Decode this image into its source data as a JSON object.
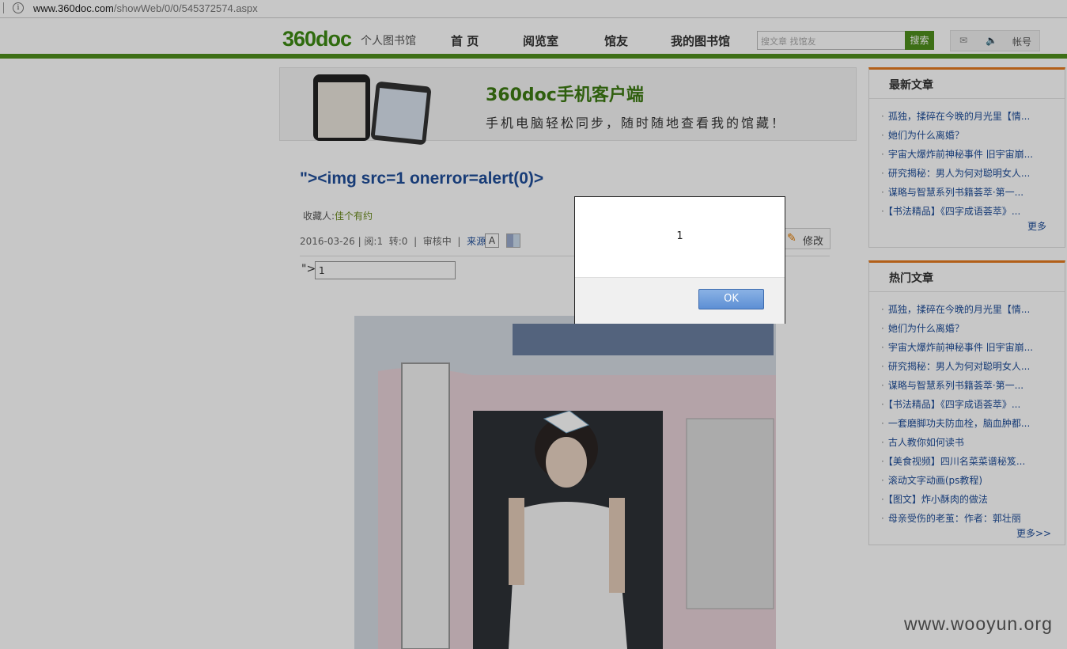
{
  "browser": {
    "url_domain": "www.360doc.com",
    "url_path": "/showWeb/0/0/545372574.aspx",
    "info_icon": "info-icon"
  },
  "header": {
    "logo": "360doc",
    "logo_sub": "个人图书馆",
    "nav": [
      "首 页",
      "阅览室",
      "馆友",
      "我的图书馆"
    ],
    "search_placeholder": "搜文章 找馆友",
    "search_button": "搜索",
    "account": "帐号",
    "icons": [
      "mail-icon",
      "sound-icon"
    ]
  },
  "banner": {
    "title": "360doc手机客户端",
    "subtitle": "手机电脑轻松同步，随时随地查看我的馆藏！"
  },
  "article": {
    "title": "\"><img src=1 onerror=alert(0)>",
    "collector_label": "收藏人:",
    "collector_name": "佳个有约",
    "date": "2016-03-26",
    "reads": "阅:1",
    "reposts": "转:0",
    "status": "审核中",
    "source": "来源",
    "font_button": "A",
    "edit_button": "修改",
    "quote_prefix": "\">",
    "input_value": "1"
  },
  "sidebar": {
    "latest": {
      "title": "最新文章",
      "items": [
        "孤独，揉碎在今晚的月光里【情...",
        "她们为什么离婚？",
        "宇宙大爆炸前神秘事件 旧宇宙崩...",
        "研究揭秘：男人为何对聪明女人...",
        "谋略与智慧系列书籍荟萃·第一...",
        "【书法精品】《四字成语荟萃》..."
      ],
      "more": "更多"
    },
    "hot": {
      "title": "热门文章",
      "items": [
        "孤独，揉碎在今晚的月光里【情...",
        "她们为什么离婚？",
        "宇宙大爆炸前神秘事件 旧宇宙崩...",
        "研究揭秘：男人为何对聪明女人...",
        "谋略与智慧系列书籍荟萃·第一...",
        "【书法精品】《四字成语荟萃》...",
        "一套磨脚功夫防血栓，脑血肿都...",
        "古人教你如何读书",
        "【美食视频】四川名菜菜谱秘笈...",
        "滚动文字动画(ps教程)",
        "【图文】炸小酥肉的做法",
        "母亲受伤的老茧：作者：郭壮丽"
      ],
      "more": "更多>>"
    }
  },
  "dialog": {
    "message": "1",
    "ok": "OK"
  },
  "watermark": "www.wooyun.org"
}
